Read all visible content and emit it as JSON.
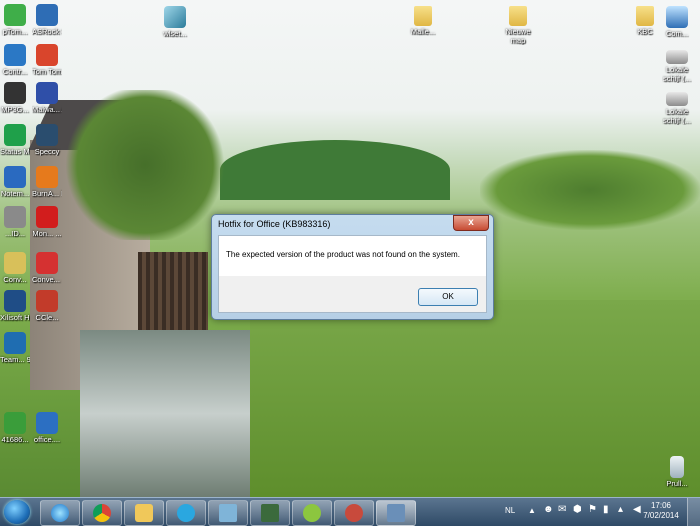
{
  "desktop": {
    "left_icons": [
      {
        "label": "pTom...",
        "name": "ptom-icon"
      },
      {
        "label": "ASRock eXtre...",
        "name": "asrock-extreme-icon"
      },
      {
        "label": "Contr...",
        "name": "control-panel-icon"
      },
      {
        "label": "Tom Tom...",
        "name": "tomtom-icon"
      },
      {
        "label": "MP3G...",
        "name": "mp3gain-icon"
      },
      {
        "label": "Malwa... Anti...",
        "name": "malwarebytes-icon"
      },
      {
        "label": "Status Moni...",
        "name": "status-monitor-icon"
      },
      {
        "label": "Speccy",
        "name": "speccy-icon"
      },
      {
        "label": "Notem...",
        "name": "notemap-icon"
      },
      {
        "label": "BurnA... Free",
        "name": "burnaware-icon"
      },
      {
        "label": "...ID...",
        "name": "id-app-icon"
      },
      {
        "label": "Mon... ...",
        "name": "monitor-app-icon"
      },
      {
        "label": "Conv...",
        "name": "converter-icon"
      },
      {
        "label": "Conve... ...",
        "name": "converter2-icon"
      },
      {
        "label": "Xilisoft HD Vi...",
        "name": "xilisoft-icon"
      },
      {
        "label": "CCle...",
        "name": "ccleaner-icon"
      },
      {
        "label": "Team... 9",
        "name": "teamviewer-icon"
      },
      {
        "label": "41686...",
        "name": "zip-file-icon"
      },
      {
        "label": "office....",
        "name": "office-setup-icon"
      }
    ],
    "top_icons": [
      {
        "label": "wlset...",
        "name": "wlset-icon"
      },
      {
        "label": "Malle...",
        "name": "folder-malle-icon"
      },
      {
        "label": "Nieuwe map",
        "name": "folder-nieuwe-map-icon"
      },
      {
        "label": "KBC",
        "name": "folder-kbc-icon"
      },
      {
        "label": "Com...",
        "name": "computer-icon"
      }
    ],
    "right_icons": [
      {
        "label": "Lokale schijf (...",
        "name": "local-disk-1-icon"
      },
      {
        "label": "Lokale schijf (...",
        "name": "local-disk-2-icon"
      },
      {
        "label": "Prull...",
        "name": "recycle-bin-icon"
      }
    ]
  },
  "dialog": {
    "title": "Hotfix for Office (KB983316)",
    "close_label": "x",
    "message": "The expected version of the product was not found on the system.",
    "ok_label": "OK"
  },
  "taskbar": {
    "language": "NL",
    "time": "17:06",
    "date": "7/02/2014"
  }
}
